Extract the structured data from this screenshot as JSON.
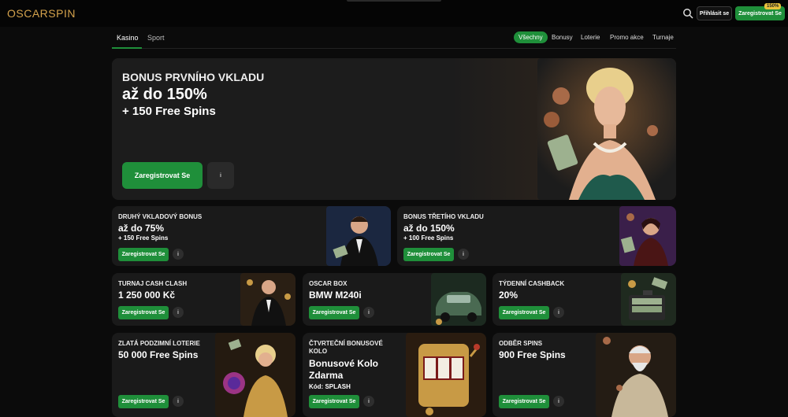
{
  "header": {
    "logo": "OSCARSPIN",
    "login_label": "Přihlásit se",
    "register_label": "Zaregistrovat Se",
    "badge": "150%"
  },
  "nav": {
    "tabs": [
      {
        "label": "Kasino",
        "active": true
      },
      {
        "label": "Sport",
        "active": false
      }
    ],
    "filters": [
      {
        "label": "Všechny",
        "active": true
      },
      {
        "label": "Bonusy",
        "active": false
      },
      {
        "label": "Loterie",
        "active": false
      },
      {
        "label": "Promo akce",
        "active": false
      },
      {
        "label": "Turnaje",
        "active": false
      }
    ]
  },
  "hero": {
    "title": "BONUS PRVNÍHO VKLADU",
    "amount": "až do 150%",
    "spins": "+ 150 Free Spins",
    "cta": "Zaregistrovat Se",
    "info": "i"
  },
  "promos_row1": [
    {
      "title": "DRUHÝ VKLADOVÝ BONUS",
      "amount": "až do 75%",
      "spins": "+ 150 Free Spins",
      "cta": "Zaregistrovat Se",
      "info": "i"
    },
    {
      "title": "BONUS TŘETÍHO VKLADU",
      "amount": "až do 150%",
      "spins": "+ 100 Free Spins",
      "cta": "Zaregistrovat Se",
      "info": "i"
    }
  ],
  "promos_row2": [
    {
      "title": "TURNAJ CASH CLASH",
      "amount": "1 250 000 Kč",
      "cta": "Zaregistrovat Se",
      "info": "i"
    },
    {
      "title": "OSCAR BOX",
      "amount": "BMW M240i",
      "cta": "Zaregistrovat Se",
      "info": "i"
    },
    {
      "title": "TÝDENNÍ CASHBACK",
      "amount": "20%",
      "cta": "Zaregistrovat Se",
      "info": "i"
    }
  ],
  "promos_row3": [
    {
      "title": "ZLATÁ PODZIMNÍ LOTERIE",
      "amount": "50 000 Free Spins",
      "cta": "Zaregistrovat Se",
      "info": "i"
    },
    {
      "title": "ČTVRTEČNÍ BONUSOVÉ KOLO",
      "amount": "Bonusové Kolo Zdarma",
      "code": "Kód: SPLASH",
      "cta": "Zaregistrovat Se",
      "info": "i"
    },
    {
      "title": "ODBĚR SPINS",
      "amount": "900 Free Spins",
      "cta": "Zaregistrovat Se",
      "info": "i"
    }
  ],
  "colors": {
    "accent": "#1f8f3a",
    "logo": "#d4a24c",
    "card": "#1a1a1a"
  }
}
